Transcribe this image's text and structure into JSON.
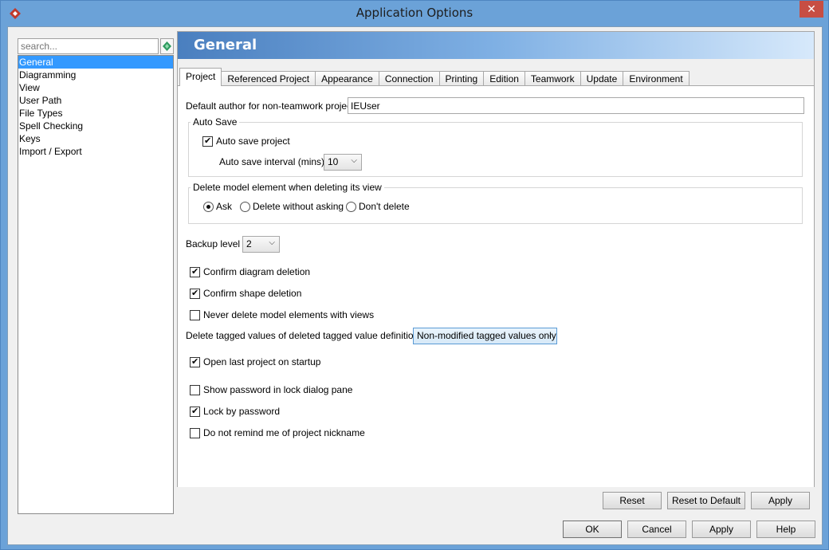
{
  "window": {
    "title": "Application Options",
    "close_glyph": "✕"
  },
  "search": {
    "placeholder": "search..."
  },
  "tree": {
    "items": [
      "General",
      "Diagramming",
      "View",
      "User Path",
      "File Types",
      "Spell Checking",
      "Keys",
      "Import / Export"
    ],
    "selected_index": 0
  },
  "header": {
    "title": "General"
  },
  "tabs": [
    "Project",
    "Referenced Project",
    "Appearance",
    "Connection",
    "Printing",
    "Edition",
    "Teamwork",
    "Update",
    "Environment"
  ],
  "active_tab": "Project",
  "project": {
    "default_author_label": "Default author for non-teamwork project:",
    "default_author_value": "IEUser",
    "auto_save": {
      "group_title": "Auto Save",
      "checkbox_label": "Auto save project",
      "checked": true,
      "interval_label": "Auto save interval (mins) :",
      "interval_value": "10"
    },
    "delete_model": {
      "group_title": "Delete model element when deleting its view",
      "options": [
        "Ask",
        "Delete without asking",
        "Don't delete"
      ],
      "selected": "Ask"
    },
    "backup_level_label": "Backup level :",
    "backup_level_value": "2",
    "confirm_diagram_deletion": {
      "label": "Confirm diagram deletion",
      "checked": true
    },
    "confirm_shape_deletion": {
      "label": "Confirm shape deletion",
      "checked": true
    },
    "never_delete_model": {
      "label": "Never delete model elements with views",
      "checked": false
    },
    "delete_tagged_label": "Delete tagged values of deleted tagged value definitions :",
    "delete_tagged_value": "Non-modified tagged values only",
    "open_last_project": {
      "label": "Open last project on startup",
      "checked": true
    },
    "show_password": {
      "label": "Show password in lock dialog pane",
      "checked": false
    },
    "lock_by_password": {
      "label": "Lock by password",
      "checked": true
    },
    "do_not_remind": {
      "label": "Do not remind me of project nickname",
      "checked": false
    }
  },
  "panel_buttons": {
    "reset": "Reset",
    "reset_default": "Reset to Default",
    "apply": "Apply"
  },
  "dialog_buttons": {
    "ok": "OK",
    "cancel": "Cancel",
    "apply": "Apply",
    "help": "Help"
  },
  "colors": {
    "title_bar": "#6ba2d8",
    "selection": "#3399ff",
    "close": "#c74e43",
    "banner_start": "#4a7fbf",
    "banner_end": "#d7e9fb"
  }
}
